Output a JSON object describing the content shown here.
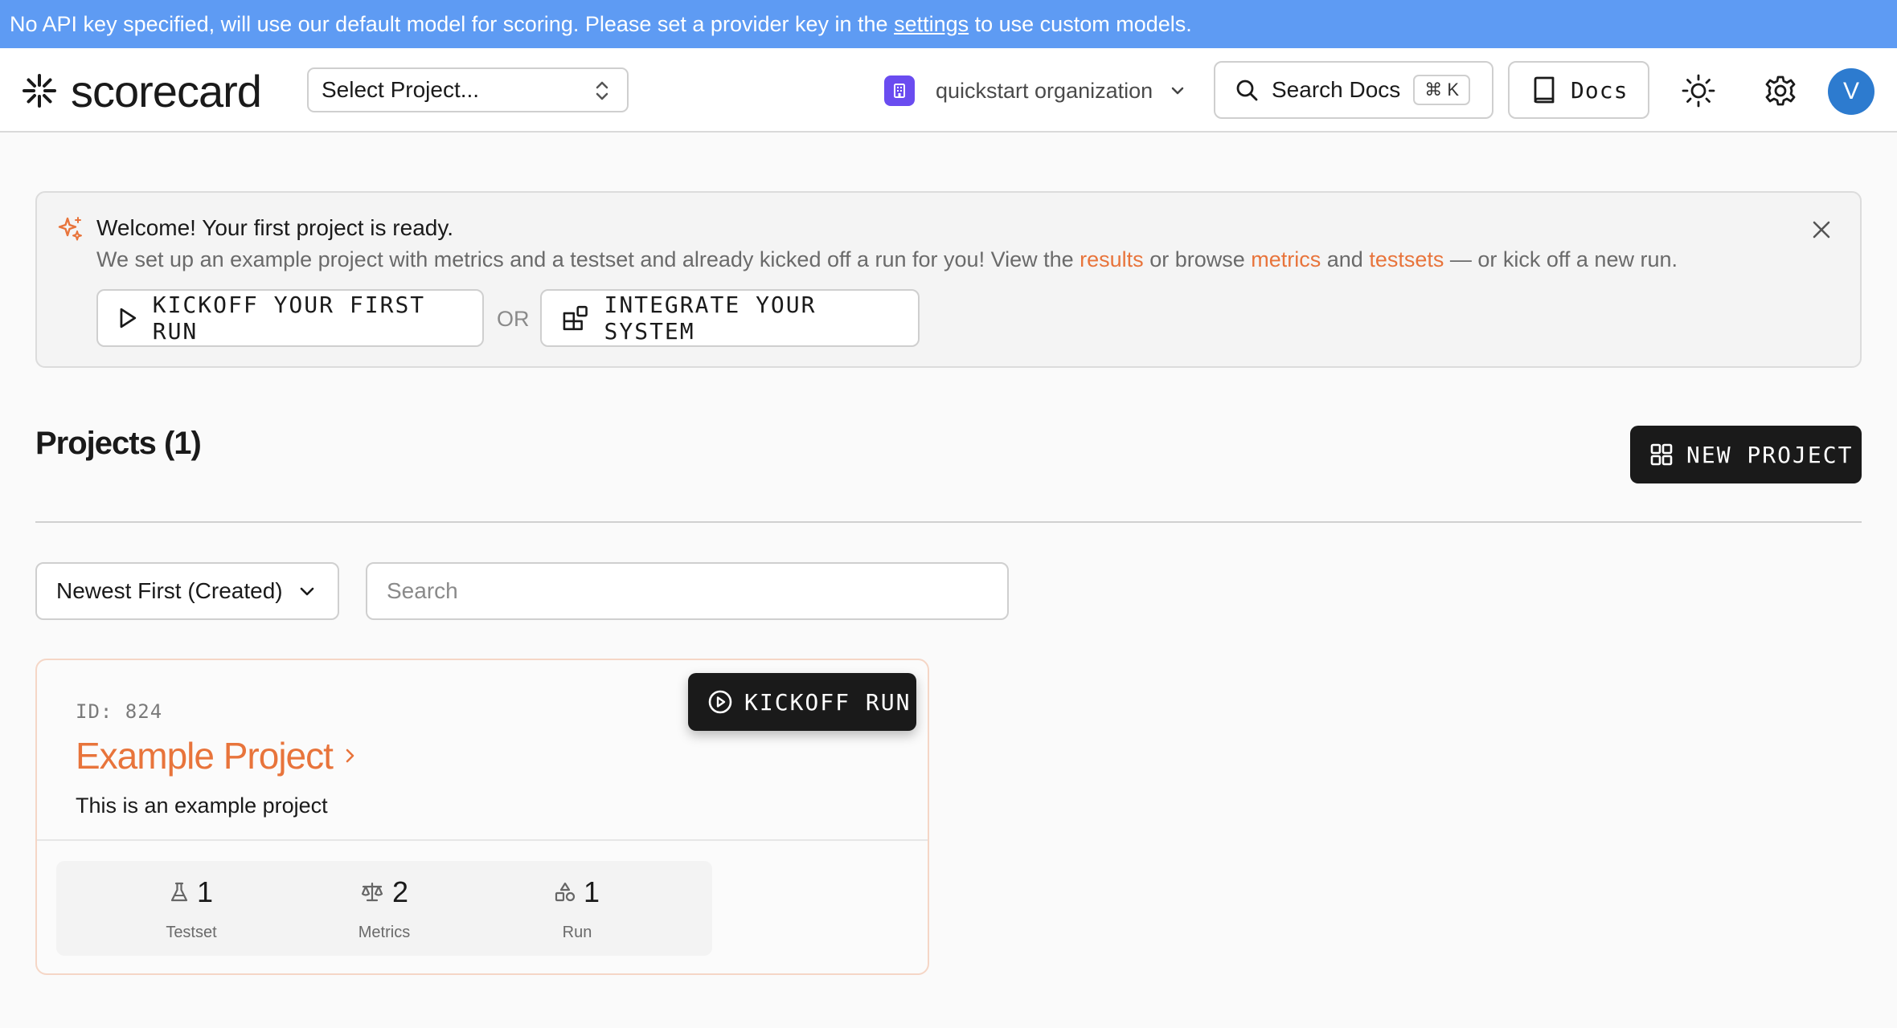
{
  "banner": {
    "text_before": "No API key specified, will use our default model for scoring. Please set a provider key in the ",
    "link": "settings",
    "text_after": " to use custom models.",
    "color": "#5e9bf3"
  },
  "header": {
    "logo_text": "scorecard",
    "project_select_placeholder": "Select Project...",
    "org_name": "quickstart organization",
    "search_label": "Search Docs",
    "search_shortcut": "⌘ K",
    "docs_label": "Docs",
    "avatar_initial": "V",
    "avatar_color": "#2d7bcf",
    "org_badge_color": "#6a4cf0"
  },
  "welcome": {
    "title": "Welcome! Your first project is ready.",
    "desc_1": "We set up an example project with metrics and a testset and already kicked off a run for you! View the ",
    "link_results": "results",
    "desc_2": " or browse ",
    "link_metrics": "metrics",
    "desc_3": " and ",
    "link_testsets": "testsets",
    "desc_4": " — or kick off a new run.",
    "kickoff_label": "KICKOFF YOUR FIRST RUN",
    "or_label": "OR",
    "integrate_label": "INTEGRATE YOUR SYSTEM",
    "accent_color": "#e8743b"
  },
  "projects": {
    "title": "Projects (1)",
    "new_project_label": "NEW PROJECT",
    "sort_label": "Newest First (Created)",
    "search_placeholder": "Search",
    "items": [
      {
        "id_label": "ID: 824",
        "name": "Example Project",
        "description": "This is an example project",
        "kickoff_label": "KICKOFF RUN",
        "stats": [
          {
            "icon": "flask-icon",
            "value": "1",
            "caption": "Testset"
          },
          {
            "icon": "scale-icon",
            "value": "2",
            "caption": "Metrics"
          },
          {
            "icon": "shapes-icon",
            "value": "1",
            "caption": "Run"
          }
        ]
      }
    ]
  }
}
